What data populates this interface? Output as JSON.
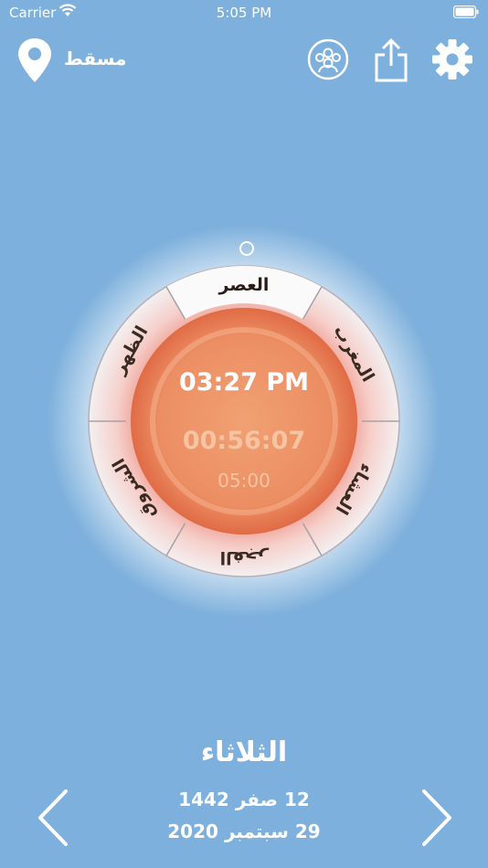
{
  "status_bar": {
    "carrier": "Carrier",
    "time": "5:05 PM"
  },
  "header": {
    "location": "مسقط"
  },
  "dial": {
    "prayers": {
      "asr": "العصر",
      "maghrib": "المغرب",
      "isha": "العشاء",
      "fajr": "الفجر",
      "sunrise": "الشروق",
      "dhuhr": "الظهر"
    },
    "active_prayer": "asr",
    "current_time": "03:27 PM",
    "remaining": "00:56:07",
    "next_time": "05:00"
  },
  "footer": {
    "day": "الثلاثاء",
    "hijri_date": "12 صفر 1442",
    "gregorian_date": "29 سبتمبر 2020"
  },
  "colors": {
    "background": "#7db0dc",
    "accent": "#ea7c52"
  },
  "icons": [
    "location-pin-icon",
    "community-icon",
    "share-icon",
    "settings-icon",
    "chevron-left-icon",
    "chevron-right-icon"
  ]
}
